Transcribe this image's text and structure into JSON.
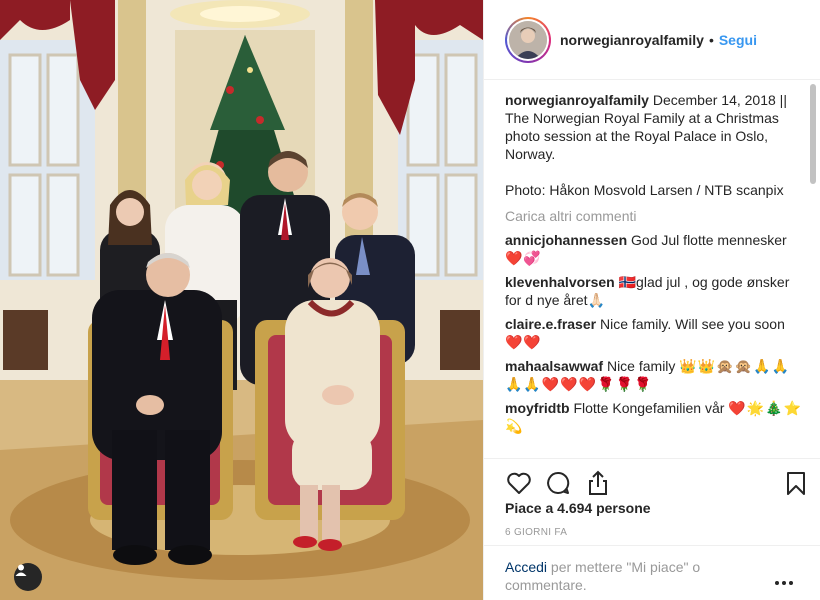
{
  "post": {
    "username": "norwegianroyalfamily",
    "separator": "•",
    "follow_label": "Segui",
    "caption": "December 14, 2018 || The Norwegian Royal Family at a Christmas photo session at the Royal Palace in Oslo, Norway.",
    "caption_credit": "Photo: Håkon Mosvold Larsen / NTB scanpix",
    "load_more": "Carica altri commenti",
    "comments": [
      {
        "user": "annicjohannessen",
        "text": "God Jul flotte mennesker",
        "emoji": "❤️💞"
      },
      {
        "user": "klevenhalvorsen",
        "text": "🇳🇴glad jul , og gode ønsker for d nye året🙏🏻",
        "emoji": ""
      },
      {
        "user": "claire.e.fraser",
        "text": "Nice family. Will see you soon",
        "emoji": "❤️❤️"
      },
      {
        "user": "mahaalsawwaf",
        "text": "Nice family",
        "emoji": "👑👑🙊🙊🙏🙏🙏🙏❤️❤️❤️🌹🌹🌹"
      },
      {
        "user": "moyfridtb",
        "text": "Flotte Kongefamilien vår",
        "emoji": "❤️🌟🎄⭐️💫"
      }
    ],
    "likes": "Piace a 4.694 persone",
    "timestamp": "6 GIORNI FA",
    "login_link": "Accedi",
    "login_text": " per mettere \"Mi piace\" o commentare."
  },
  "icons": {
    "like": "heart-outline-icon",
    "comment": "comment-bubble-icon",
    "share": "share-icon",
    "save": "bookmark-icon",
    "more": "more-dots-icon",
    "user_tag": "person-tag-icon"
  },
  "colors": {
    "accent": "#3897f0",
    "link": "#003569",
    "muted": "#999999",
    "text": "#262626"
  }
}
